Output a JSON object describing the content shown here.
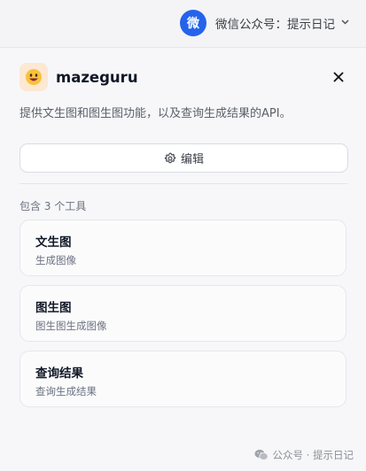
{
  "account": {
    "avatar_char": "微",
    "label": "微信公众号：提示日记",
    "chevron": "⌄"
  },
  "tool": {
    "name": "mazeguru",
    "description": "提供文生图和图生图功能，以及查询生成结果的API。",
    "close_symbol": "✕",
    "edit_label": "编辑",
    "count_label": "包含 3 个工具"
  },
  "tools": [
    {
      "title": "文生图",
      "subtitle": "生成图像"
    },
    {
      "title": "图生图",
      "subtitle": "图生图生成图像"
    },
    {
      "title": "查询结果",
      "subtitle": "查询生成结果"
    }
  ],
  "watermark": {
    "text": "公众号 · 提示日记"
  },
  "icons": {
    "logo": "grinning-face-icon",
    "edit": "gear-icon",
    "close": "close-icon",
    "chevron": "chevron-down-icon",
    "watermark": "wechat-icon"
  },
  "colors": {
    "avatar": "#2563eb",
    "logo_bg": "#fde8d2",
    "page_bg": "#f7f7f9"
  }
}
